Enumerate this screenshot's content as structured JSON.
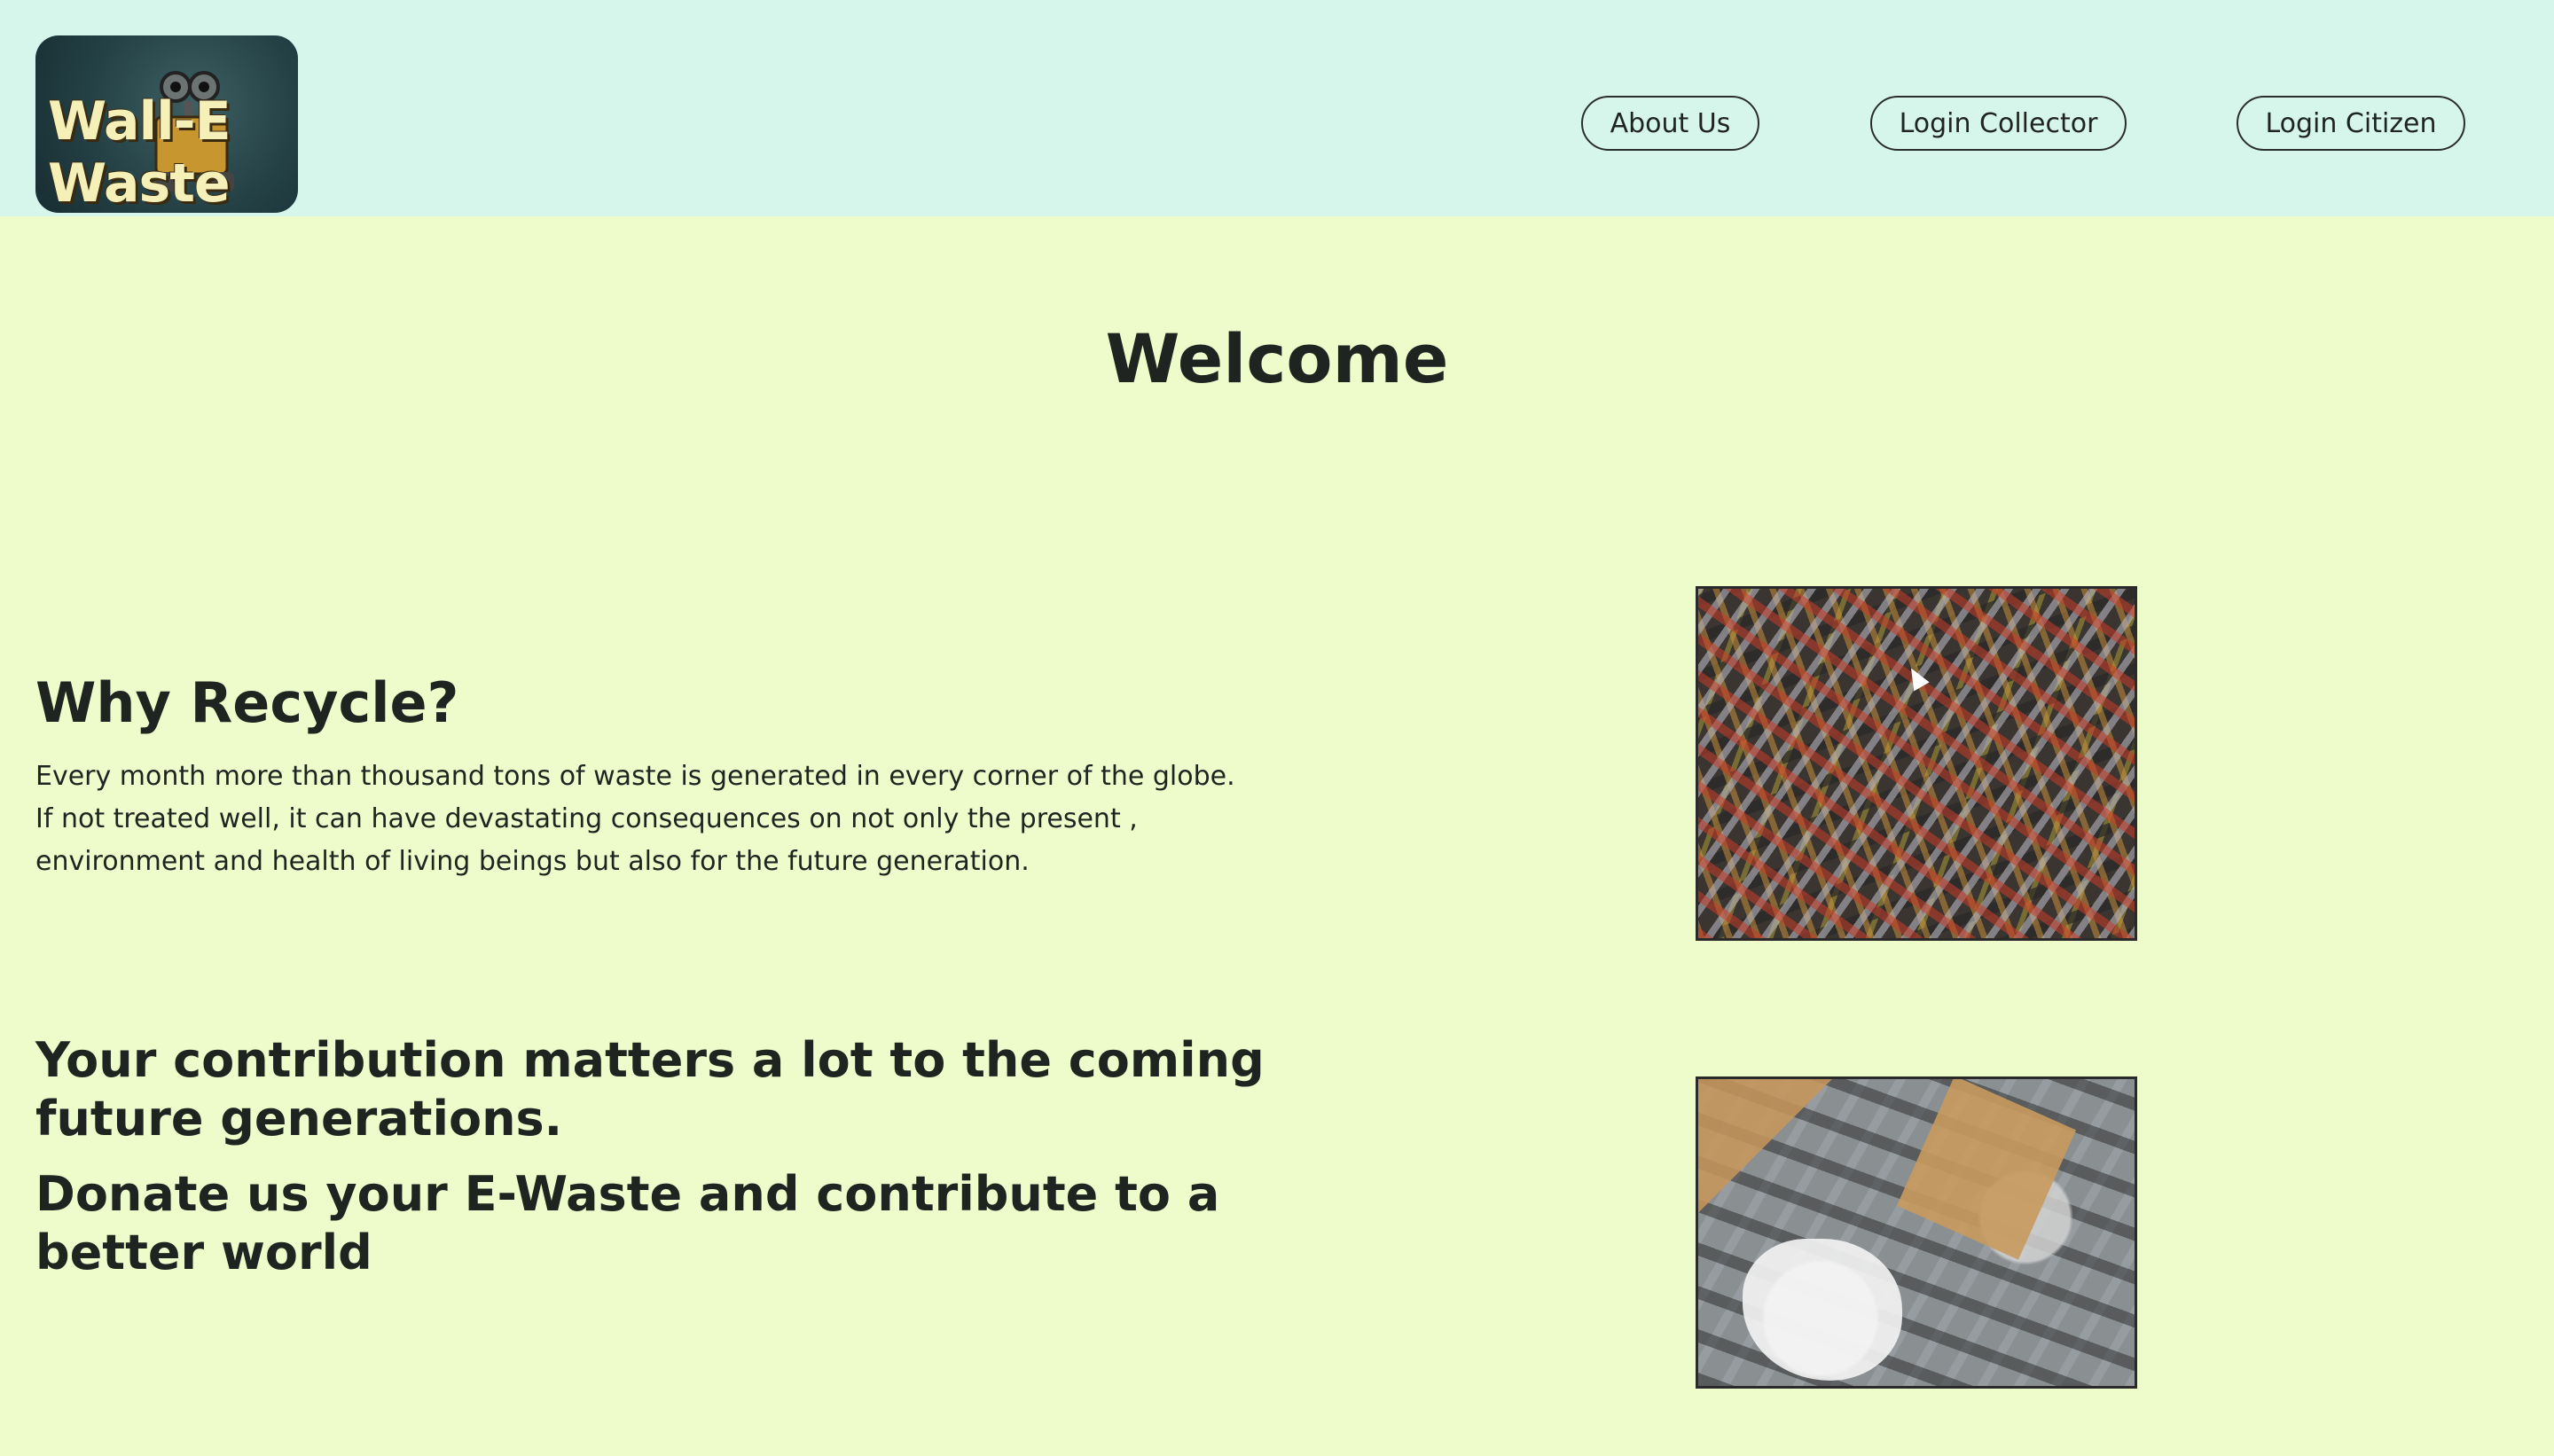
{
  "header": {
    "logo_text_line1": "Wall-E",
    "logo_text_line2": "Waste",
    "nav": {
      "about_label": "About Us",
      "login_collector_label": "Login Collector",
      "login_citizen_label": "Login Citizen"
    }
  },
  "main": {
    "welcome_title": "Welcome",
    "why_recycle": {
      "title": "Why Recycle?",
      "body": "Every month more than thousand tons of waste is generated in every corner of the globe. If not treated well, it can have devastating consequences on not only the present , environment and health of living beings but also for the future generation."
    },
    "cta_line1": "Your contribution matters a lot to the coming future generations.",
    "cta_line2": "Donate us your E-Waste and contribute to a better world"
  },
  "colors": {
    "header_bg": "#d6f6ec",
    "page_bg": "#eefccc",
    "text": "#1f2420"
  }
}
